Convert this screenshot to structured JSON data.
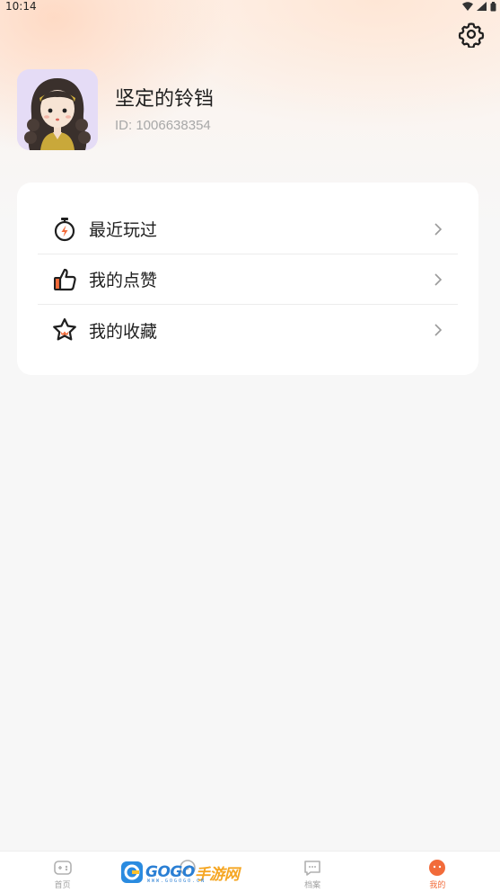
{
  "status_bar": {
    "time": "10:14"
  },
  "profile": {
    "username": "坚定的铃铛",
    "user_id": "ID: 1006638354"
  },
  "menu": {
    "items": [
      {
        "label": "最近玩过",
        "icon": "stopwatch-icon"
      },
      {
        "label": "我的点赞",
        "icon": "thumbs-up-icon"
      },
      {
        "label": "我的收藏",
        "icon": "star-icon"
      }
    ]
  },
  "tabs": [
    {
      "label": "首页",
      "icon": "gamepad-icon",
      "active": false
    },
    {
      "label": "",
      "icon": "compass-icon",
      "active": false
    },
    {
      "label": "档案",
      "icon": "chat-bubble-icon",
      "active": false
    },
    {
      "label": "我的",
      "icon": "profile-icon",
      "active": true
    }
  ],
  "watermark": {
    "brand_a": "GOGO",
    "brand_b": "手游网",
    "sub": "WWW.GOGOGO.CN"
  },
  "colors": {
    "accent": "#f26b3a",
    "background": "#f7f7f7",
    "card": "#ffffff",
    "muted_text": "#a8a8a8"
  }
}
